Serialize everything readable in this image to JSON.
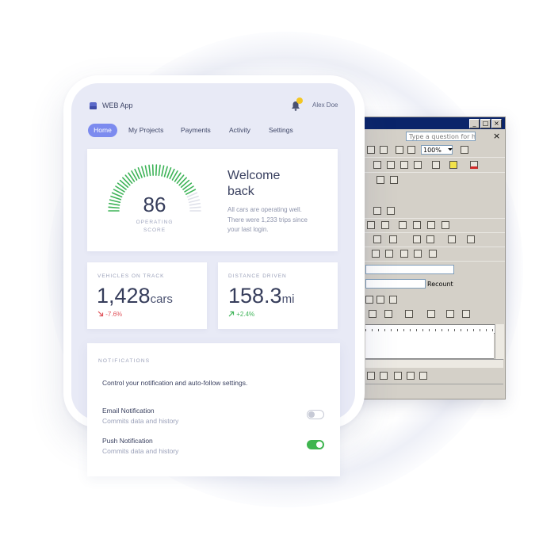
{
  "app": {
    "name": "WEB App",
    "user": "Alex Doe",
    "notification_count_shown": true
  },
  "nav": {
    "tabs": [
      {
        "label": "Home",
        "active": true
      },
      {
        "label": "My Projects",
        "active": false
      },
      {
        "label": "Payments",
        "active": false
      },
      {
        "label": "Activity",
        "active": false
      },
      {
        "label": "Settings",
        "active": false
      }
    ]
  },
  "score": {
    "value": "86",
    "label_line1": "OPERATING",
    "label_line2": "SCORE",
    "fraction": 0.86,
    "accent": "#3db357",
    "track": "#dfe1ea"
  },
  "welcome": {
    "line1": "Welcome",
    "line2": "back",
    "sub1": "All cars are operating well.",
    "sub2": "There were 1,233 trips since",
    "sub3": "your last login."
  },
  "stats": {
    "vehicles": {
      "label": "VEHICLES ON TRACK",
      "value": "1,428",
      "unit": "cars",
      "delta": "-7.6%",
      "delta_icon": "arrow-down-right-icon"
    },
    "distance": {
      "label": "DISTANCE DRIVEN",
      "value": "158.3",
      "unit": "mi",
      "delta": "+2.4%",
      "delta_icon": "arrow-up-right-icon"
    }
  },
  "notifications": {
    "title": "NOTIFICATIONS",
    "description": "Control your notification and auto-follow settings.",
    "items": [
      {
        "name": "Email Notification",
        "sub": "Commits data and history",
        "enabled": false
      },
      {
        "name": "Push Notification",
        "sub": "Commits data and history",
        "enabled": true
      }
    ]
  },
  "legacy_window": {
    "help_placeholder": "Type a question for help",
    "zoom": "100%",
    "recount": "Recount"
  },
  "colors": {
    "primary": "#7c8bef",
    "screen_bg": "#e8eaf6",
    "negative": "#e0545c",
    "positive": "#3db357"
  }
}
